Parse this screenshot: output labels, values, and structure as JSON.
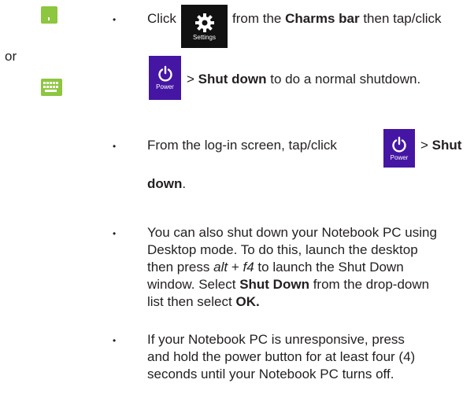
{
  "sidebar": {
    "touchpad_icon": "touchpad-gesture-icon",
    "or_label": "or",
    "keyboard_icon": "keyboard-icon"
  },
  "icons": {
    "settings_label": "Settings",
    "power_label": "Power",
    "power_label_2": "Power",
    "tile_color": "#4516a3",
    "settings_tile_color": "#111111",
    "accent_green": "#8dc63f"
  },
  "steps": {
    "bullet": "•",
    "step1": {
      "click": "Click",
      "from_the": "from  the",
      "charms_bar": "Charms bar",
      "then_tap": "then tap/click",
      "gt": ">",
      "shut_down": "Shut down",
      "normal_shutdown": "to do a normal shutdown."
    },
    "step2": {
      "prefix": "From the log-in screen, tap/click",
      "gt": ">",
      "shut": "Shut",
      "down": "down",
      "period": "."
    },
    "step3": {
      "line1": "You can also shut down your Notebook PC using",
      "line2": "Desktop mode. To do this, launch the desktop",
      "then_press": "then press",
      "alt": "alt",
      "plus": "+",
      "f4": "f4",
      "launch_window": "to launch the Shut Down",
      "window_select": "window. Select",
      "shut_down_bold": "Shut Down",
      "from_dropdown": "from the drop-down",
      "list_then": "list then select",
      "ok": "OK."
    },
    "step4": {
      "line1": "If your Notebook PC is unresponsive, press",
      "line2": "and hold the power button for at least four (4)",
      "line3": "seconds until your Notebook PC turns off."
    }
  }
}
